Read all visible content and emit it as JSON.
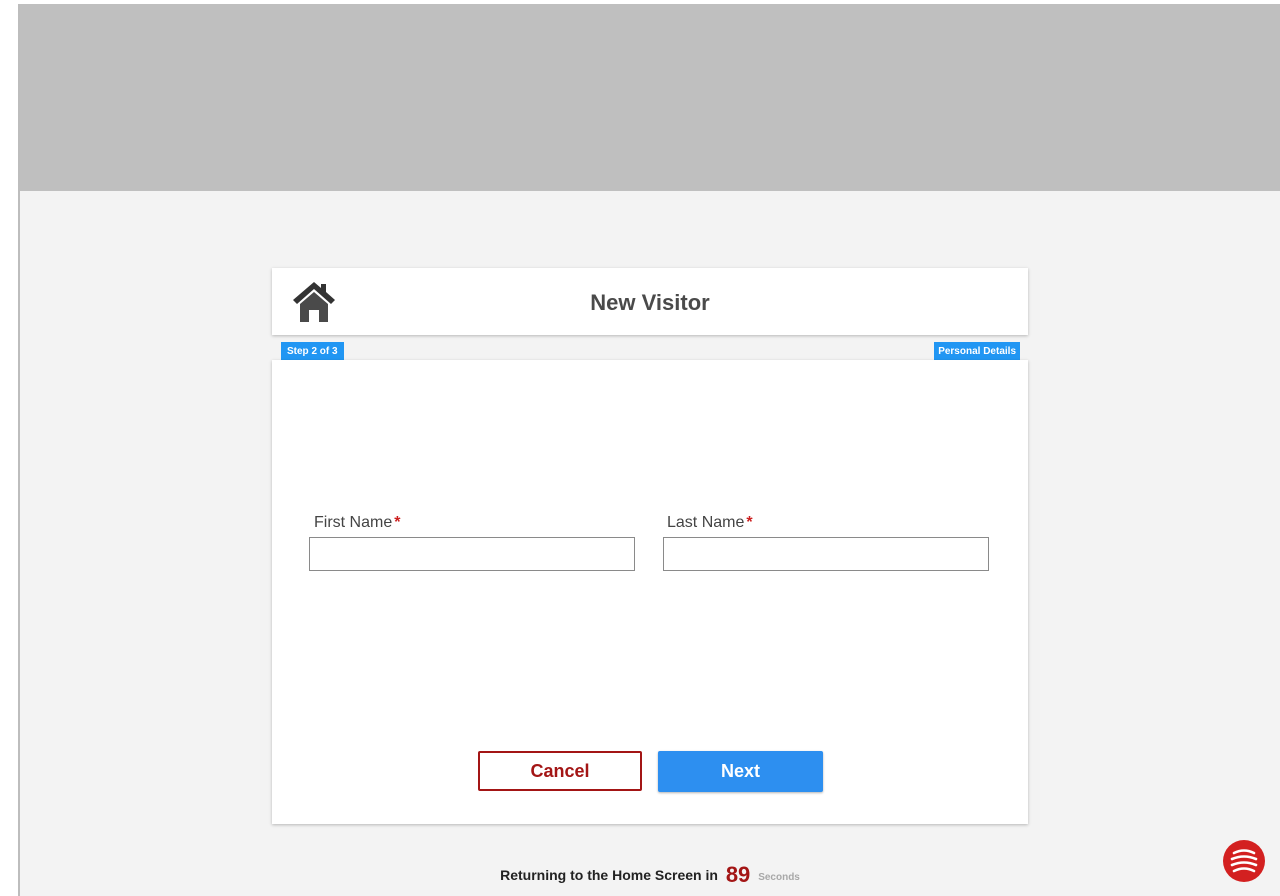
{
  "header": {
    "title": "New Visitor",
    "home_icon": "home-icon"
  },
  "steps": {
    "step_label": "Step 2 of 3",
    "section_label": "Personal Details"
  },
  "form": {
    "first_name": {
      "label": "First Name",
      "required_mark": "*",
      "value": ""
    },
    "last_name": {
      "label": "Last Name",
      "required_mark": "*",
      "value": ""
    }
  },
  "actions": {
    "cancel_label": "Cancel",
    "next_label": "Next"
  },
  "timeout": {
    "prefix": "Returning to the Home Screen in",
    "count": "89",
    "unit": "Seconds"
  },
  "colors": {
    "accent_blue": "#2196f3",
    "danger_red": "#a31515",
    "banner_gray": "#bfbfbf",
    "background": "#f3f3f3"
  },
  "brand": {
    "logo_icon": "brand-logo-icon"
  }
}
